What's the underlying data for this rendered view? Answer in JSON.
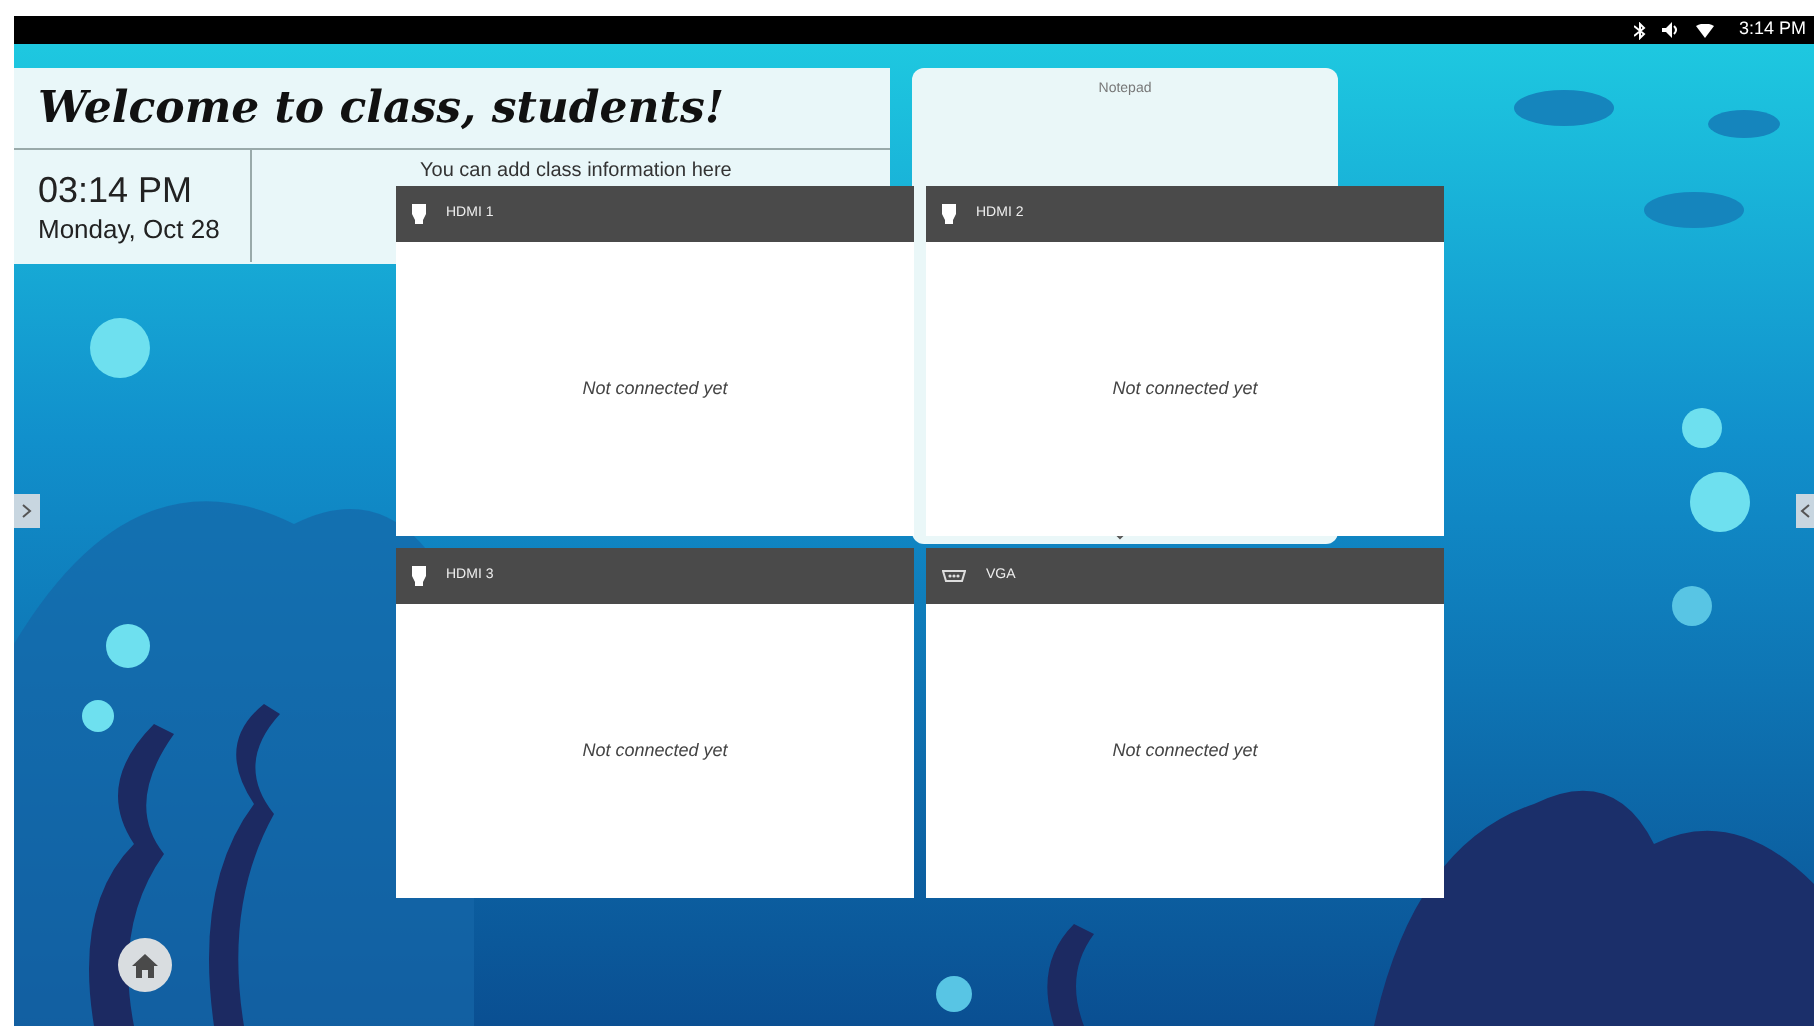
{
  "status_bar": {
    "time": "3:14 PM"
  },
  "welcome": {
    "title": "Welcome to class, students!",
    "time": "03:14 PM",
    "date": "Monday, Oct 28",
    "info": "You can add class information here"
  },
  "notepad": {
    "title": "Notepad"
  },
  "inputs": [
    {
      "label": "HDMI 1",
      "kind": "hdmi",
      "status": "Not connected yet"
    },
    {
      "label": "HDMI 2",
      "kind": "hdmi",
      "status": "Not connected yet"
    },
    {
      "label": "HDMI 3",
      "kind": "hdmi",
      "status": "Not connected yet"
    },
    {
      "label": "VGA",
      "kind": "vga",
      "status": "Not connected yet"
    }
  ]
}
